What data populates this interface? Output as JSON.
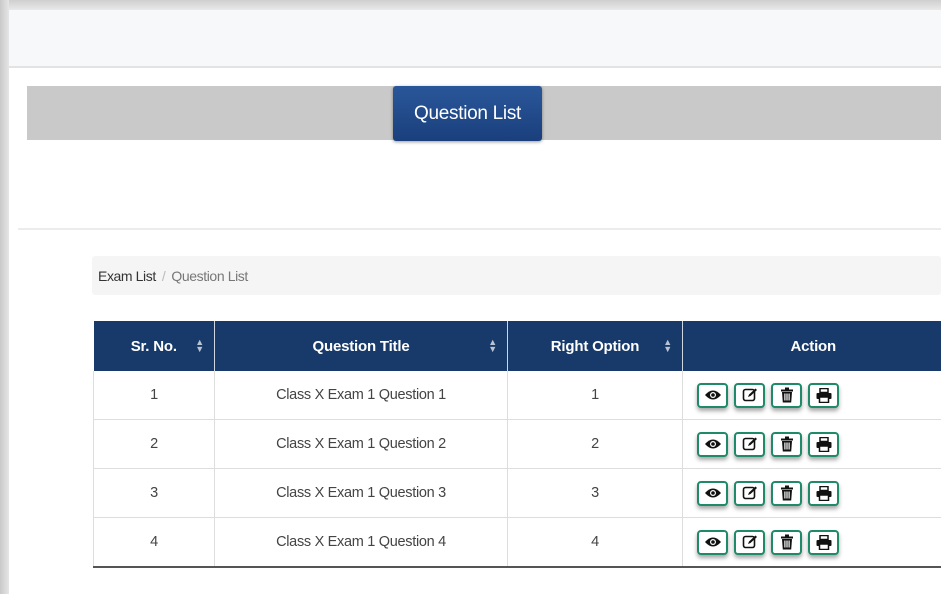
{
  "header": {
    "title_button": "Question List"
  },
  "breadcrumb": {
    "parent": "Exam List",
    "separator": "/",
    "current": "Question List"
  },
  "table": {
    "columns": [
      "Sr. No.",
      "Question Title",
      "Right Option",
      "Action"
    ],
    "rows": [
      {
        "sr": "1",
        "title": "Class X Exam 1 Question 1",
        "option": "1"
      },
      {
        "sr": "2",
        "title": "Class X Exam 1 Question 2",
        "option": "2"
      },
      {
        "sr": "3",
        "title": "Class X Exam 1 Question 3",
        "option": "3"
      },
      {
        "sr": "4",
        "title": "Class X Exam 1 Question 4",
        "option": "4"
      }
    ],
    "actions": [
      "eye-icon",
      "edit-icon",
      "trash-icon",
      "print-icon"
    ]
  },
  "colors": {
    "header_bg": "#173a6a",
    "button_bg": "#1a3f7c",
    "action_border": "#1f8a6a"
  }
}
